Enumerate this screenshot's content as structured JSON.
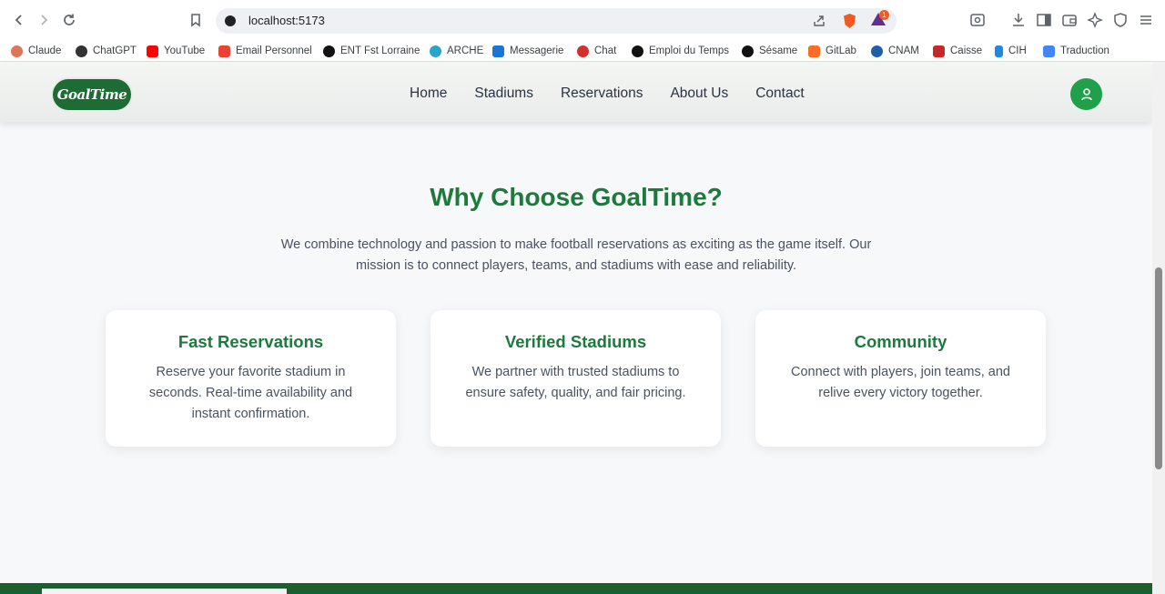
{
  "browser": {
    "url": "localhost:5173",
    "brave_badge": "1",
    "bookmarks": [
      {
        "label": "Claude",
        "color": "#d97757"
      },
      {
        "label": "ChatGPT",
        "color": "#333333"
      },
      {
        "label": "YouTube",
        "color": "#ff0000"
      },
      {
        "label": "Email Personnel",
        "color": "#ea4335"
      },
      {
        "label": "ENT Fst Lorraine",
        "color": "#111111"
      },
      {
        "label": "ARCHE",
        "color": "#2aa4c9"
      },
      {
        "label": "Messagerie",
        "color": "#1976d2"
      },
      {
        "label": "Chat",
        "color": "#d32f2f"
      },
      {
        "label": "Emploi du Temps",
        "color": "#111111"
      },
      {
        "label": "Sésame",
        "color": "#111111"
      },
      {
        "label": "GitLab",
        "color": "#fc6d26"
      },
      {
        "label": "CNAM",
        "color": "#1f5fa8"
      },
      {
        "label": "Caisse",
        "color": "#c62828"
      },
      {
        "label": "CIH",
        "color": "#1e88e5"
      },
      {
        "label": "Traduction",
        "color": "#4285f4"
      }
    ]
  },
  "header": {
    "logo_text": "GoalTime",
    "nav": [
      "Home",
      "Stadiums",
      "Reservations",
      "About Us",
      "Contact"
    ]
  },
  "section": {
    "title": "Why Choose GoalTime?",
    "subtitle": "We combine technology and passion to make football reservations as exciting as the game itself. Our mission is to connect players, teams, and stadiums with ease and reliability.",
    "cards": [
      {
        "title": "Fast Reservations",
        "text": "Reserve your favorite stadium in seconds. Real-time availability and instant confirmation."
      },
      {
        "title": "Verified Stadiums",
        "text": "We partner with trusted stadiums to ensure safety, quality, and fair pricing."
      },
      {
        "title": "Community",
        "text": "Connect with players, join teams, and relive every victory together."
      }
    ]
  },
  "colors": {
    "accent_green": "#1c7a3c",
    "user_button": "#21a04b",
    "footer": "#1b5e30"
  }
}
